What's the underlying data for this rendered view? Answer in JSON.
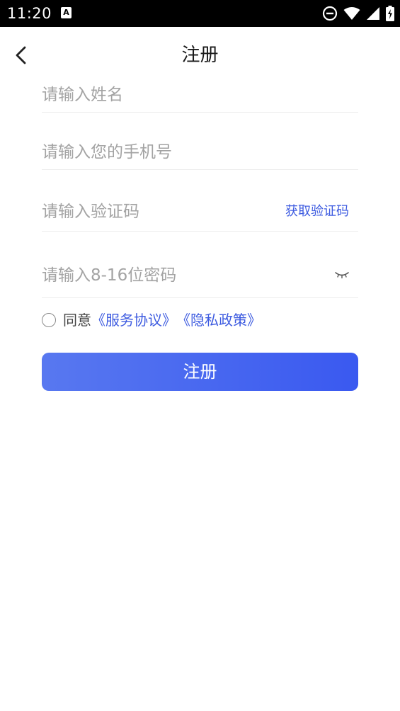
{
  "status_bar": {
    "time": "11:20",
    "notification_badge": "A"
  },
  "header": {
    "title": "注册"
  },
  "form": {
    "name_placeholder": "请输入姓名",
    "phone_placeholder": "请输入您的手机号",
    "code_placeholder": "请输入验证码",
    "get_code_label": "获取验证码",
    "password_placeholder": "请输入8-16位密码"
  },
  "agreement": {
    "prefix": "同意",
    "service_link": "《服务协议》",
    "privacy_link": "《隐私政策》"
  },
  "submit_label": "注册",
  "colors": {
    "accent": "#3d5be0",
    "button_start": "#5878f0",
    "button_end": "#3a59f0"
  }
}
